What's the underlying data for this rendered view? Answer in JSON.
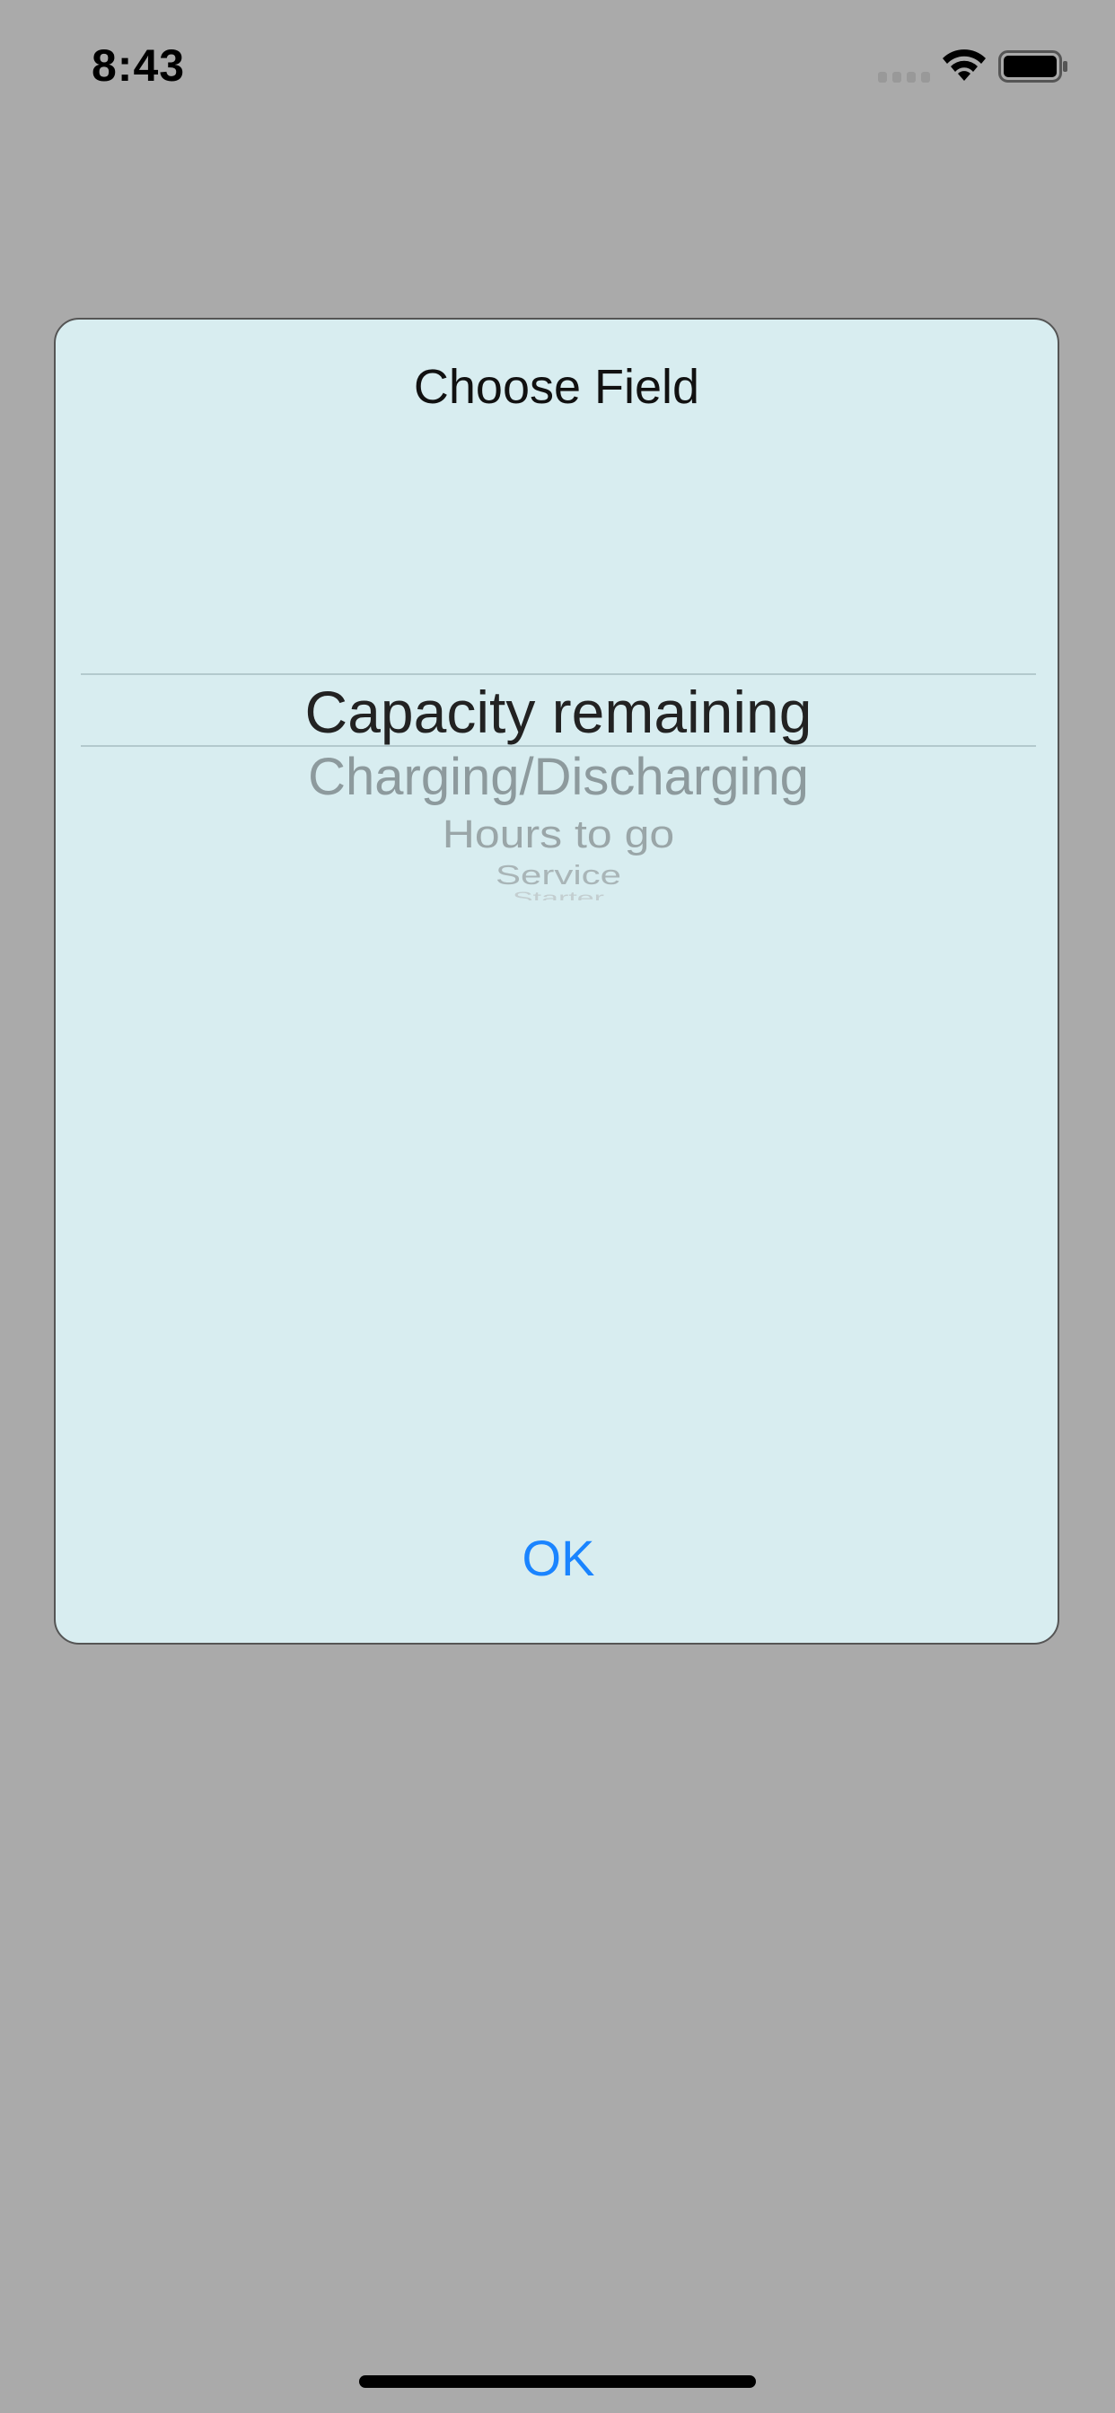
{
  "status_bar": {
    "time": "8:43",
    "icons": [
      "signal-icon",
      "wifi-icon",
      "battery-icon"
    ]
  },
  "dialog": {
    "title": "Choose Field",
    "picker": {
      "selected": "Capacity remaining",
      "items": [
        "Capacity remaining",
        "Charging/Discharging",
        "Hours to go",
        "Service",
        "Starter"
      ]
    },
    "ok_label": "OK"
  },
  "colors": {
    "background": "#aaaaaa",
    "dialog_background": "#d8edf0",
    "accent": "#1a84ff"
  }
}
